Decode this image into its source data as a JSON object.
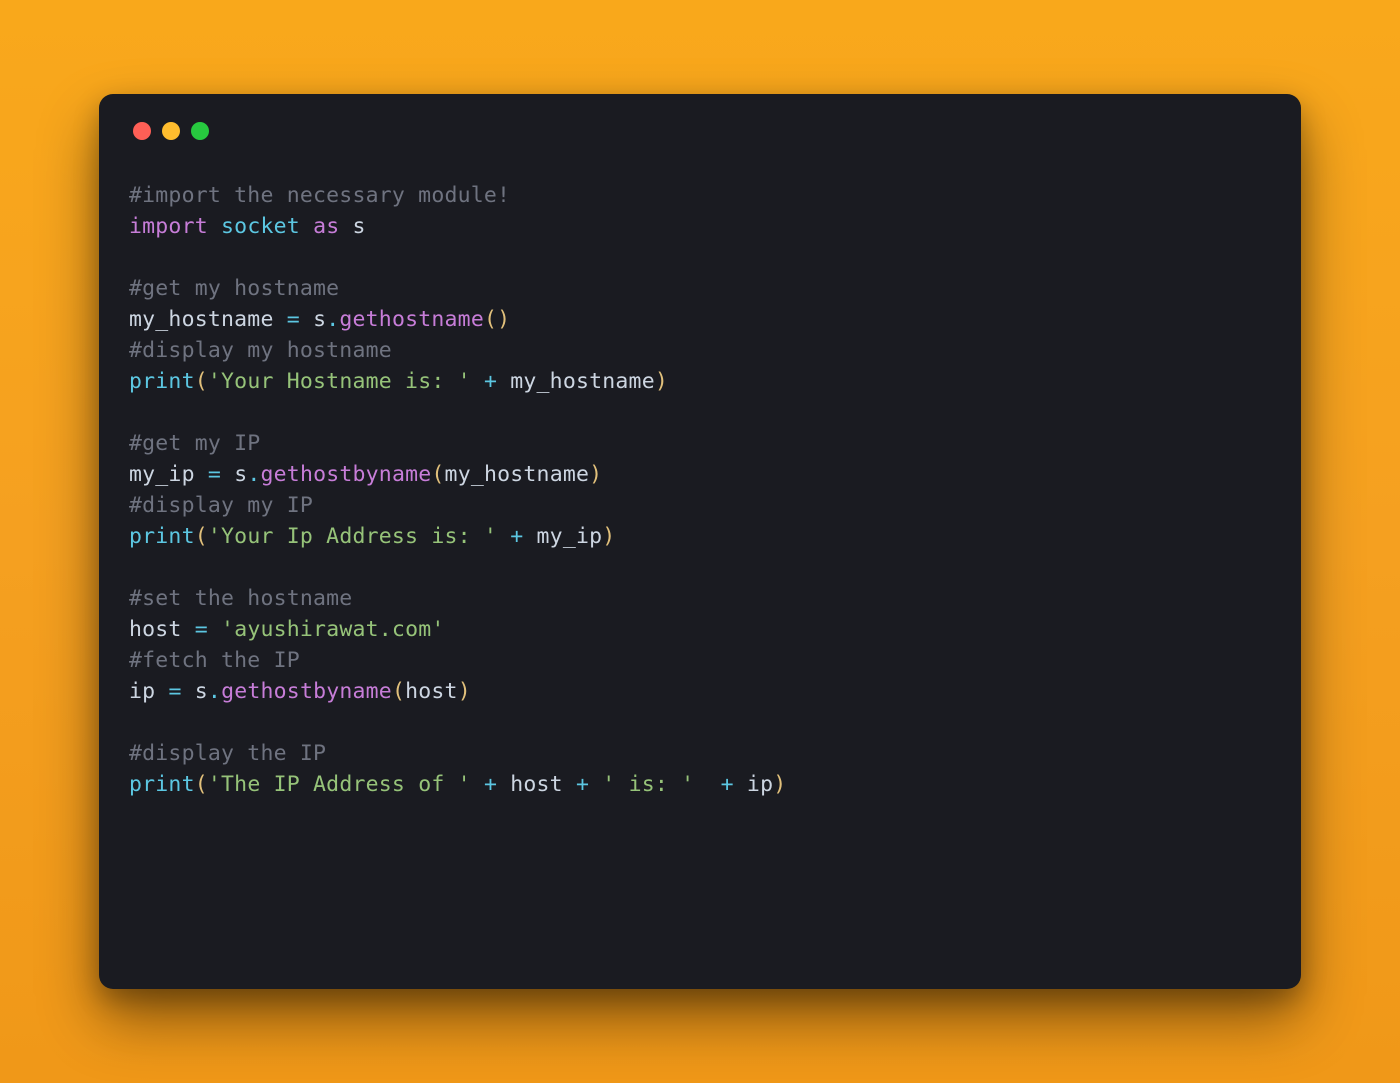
{
  "colors": {
    "bg": "#f5a020",
    "window": "#1a1b21",
    "close": "#ff5f56",
    "min": "#ffbd2e",
    "max": "#27c93f"
  },
  "code": {
    "l1_comment": "#import the necessary module!",
    "l2_kw_import": "import",
    "l2_module": "socket",
    "l2_kw_as": "as",
    "l2_alias": "s",
    "l4_comment": "#get my hostname",
    "l5_var": "my_hostname",
    "l5_eq": "=",
    "l5_obj": "s",
    "l5_dot": ".",
    "l5_fn": "gethostname",
    "l5_paren_open": "(",
    "l5_paren_close": ")",
    "l6_comment": "#display my hostname",
    "l7_print": "print",
    "l7_paren_open": "(",
    "l7_str": "'Your Hostname is: '",
    "l7_plus": "+",
    "l7_var": "my_hostname",
    "l7_paren_close": ")",
    "l9_comment": "#get my IP",
    "l10_var": "my_ip",
    "l10_eq": "=",
    "l10_obj": "s",
    "l10_dot": ".",
    "l10_fn": "gethostbyname",
    "l10_paren_open": "(",
    "l10_arg": "my_hostname",
    "l10_paren_close": ")",
    "l11_comment": "#display my IP",
    "l12_print": "print",
    "l12_paren_open": "(",
    "l12_str": "'Your Ip Address is: '",
    "l12_plus": "+",
    "l12_var": "my_ip",
    "l12_paren_close": ")",
    "l14_comment": "#set the hostname",
    "l15_var": "host",
    "l15_eq": "=",
    "l15_str": "'ayushirawat.com'",
    "l16_comment": "#fetch the IP",
    "l17_var": "ip",
    "l17_eq": "=",
    "l17_obj": "s",
    "l17_dot": ".",
    "l17_fn": "gethostbyname",
    "l17_paren_open": "(",
    "l17_arg": "host",
    "l17_paren_close": ")",
    "l19_comment": "#display the IP",
    "l20_print": "print",
    "l20_paren_open": "(",
    "l20_str1": "'The IP Address of '",
    "l20_plus1": "+",
    "l20_var1": "host",
    "l20_plus2": "+",
    "l20_str2": "' is: '",
    "l20_plus3": "+",
    "l20_var2": "ip",
    "l20_paren_close": ")"
  }
}
